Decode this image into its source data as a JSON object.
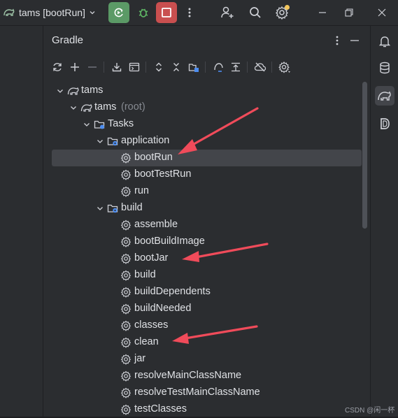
{
  "titlebar": {
    "run_config": "tams [bootRun]"
  },
  "panel": {
    "title": "Gradle"
  },
  "tree": [
    {
      "label": "tams",
      "hint": "",
      "icon": "gradle-elephant-icon",
      "depth": 0,
      "expandable": true,
      "selected": false
    },
    {
      "label": "tams",
      "hint": "(root)",
      "icon": "gradle-elephant-icon",
      "depth": 1,
      "expandable": true,
      "selected": false
    },
    {
      "label": "Tasks",
      "hint": "",
      "icon": "folder-icon",
      "depth": 2,
      "expandable": true,
      "selected": false
    },
    {
      "label": "application",
      "hint": "",
      "icon": "task-folder-icon",
      "depth": 3,
      "expandable": true,
      "selected": false
    },
    {
      "label": "bootRun",
      "hint": "",
      "icon": "gear-icon",
      "depth": 4,
      "expandable": false,
      "selected": true
    },
    {
      "label": "bootTestRun",
      "hint": "",
      "icon": "gear-icon",
      "depth": 4,
      "expandable": false,
      "selected": false
    },
    {
      "label": "run",
      "hint": "",
      "icon": "gear-icon",
      "depth": 4,
      "expandable": false,
      "selected": false
    },
    {
      "label": "build",
      "hint": "",
      "icon": "task-folder-icon",
      "depth": 3,
      "expandable": true,
      "selected": false
    },
    {
      "label": "assemble",
      "hint": "",
      "icon": "gear-icon",
      "depth": 4,
      "expandable": false,
      "selected": false
    },
    {
      "label": "bootBuildImage",
      "hint": "",
      "icon": "gear-icon",
      "depth": 4,
      "expandable": false,
      "selected": false
    },
    {
      "label": "bootJar",
      "hint": "",
      "icon": "gear-icon",
      "depth": 4,
      "expandable": false,
      "selected": false
    },
    {
      "label": "build",
      "hint": "",
      "icon": "gear-icon",
      "depth": 4,
      "expandable": false,
      "selected": false
    },
    {
      "label": "buildDependents",
      "hint": "",
      "icon": "gear-icon",
      "depth": 4,
      "expandable": false,
      "selected": false
    },
    {
      "label": "buildNeeded",
      "hint": "",
      "icon": "gear-icon",
      "depth": 4,
      "expandable": false,
      "selected": false
    },
    {
      "label": "classes",
      "hint": "",
      "icon": "gear-icon",
      "depth": 4,
      "expandable": false,
      "selected": false
    },
    {
      "label": "clean",
      "hint": "",
      "icon": "gear-icon",
      "depth": 4,
      "expandable": false,
      "selected": false
    },
    {
      "label": "jar",
      "hint": "",
      "icon": "gear-icon",
      "depth": 4,
      "expandable": false,
      "selected": false
    },
    {
      "label": "resolveMainClassName",
      "hint": "",
      "icon": "gear-icon",
      "depth": 4,
      "expandable": false,
      "selected": false
    },
    {
      "label": "resolveTestMainClassName",
      "hint": "",
      "icon": "gear-icon",
      "depth": 4,
      "expandable": false,
      "selected": false
    },
    {
      "label": "testClasses",
      "hint": "",
      "icon": "gear-icon",
      "depth": 4,
      "expandable": false,
      "selected": false
    }
  ],
  "annotations": [
    {
      "name": "arrow-to-bootRun",
      "color": "#f04b5a"
    },
    {
      "name": "arrow-to-bootJar",
      "color": "#f04b5a"
    },
    {
      "name": "arrow-to-clean",
      "color": "#f04b5a"
    }
  ],
  "watermark": "CSDN @闲一杯",
  "colors": {
    "background": "#2b2d30",
    "run_button": "#5b9a66",
    "stop_button": "#c94f4f",
    "selection": "#43454a",
    "annotation_arrow": "#f04b5a",
    "notification_dot": "#f2c55c"
  }
}
